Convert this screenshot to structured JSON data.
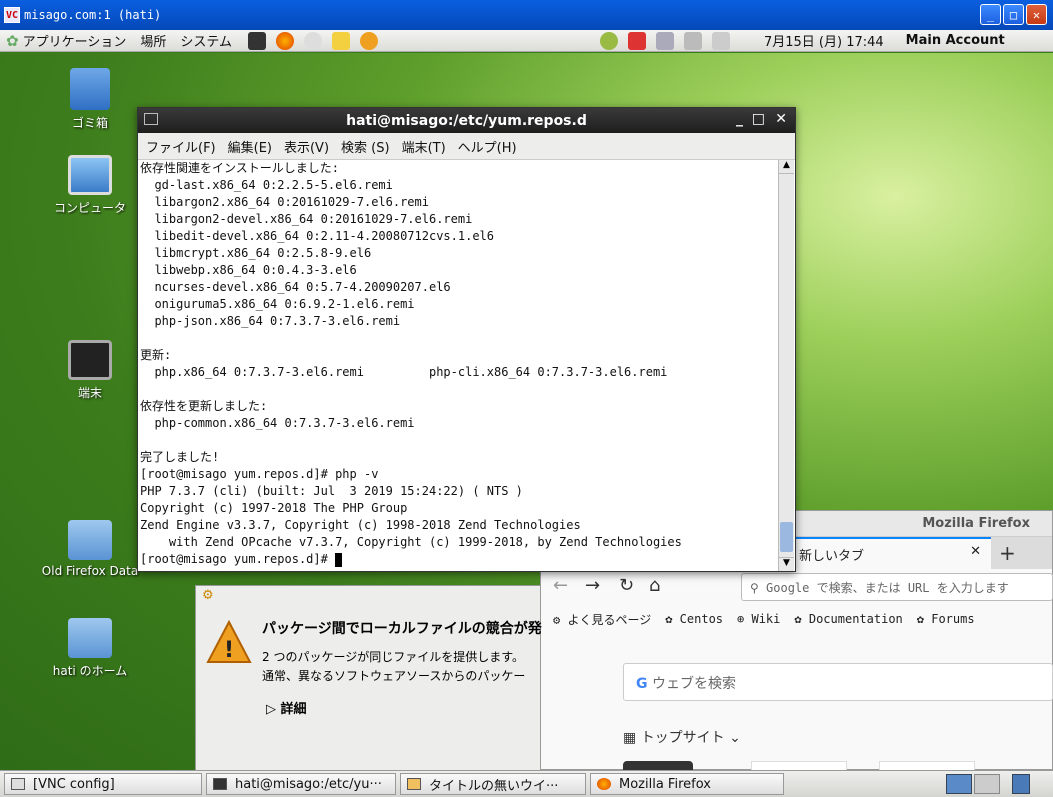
{
  "vnc": {
    "title": "misago.com:1 (hati)",
    "logo": "VC"
  },
  "panel": {
    "menus": [
      "アプリケーション",
      "場所",
      "システム"
    ],
    "clock": "7月15日 (月) 17:44",
    "account": "Main Account"
  },
  "desktop_icons": [
    "ゴミ箱",
    "コンピュータ",
    "端末",
    "Old Firefox Data",
    "hati のホーム"
  ],
  "terminal": {
    "title": "hati@misago:/etc/yum.repos.d",
    "menu": [
      "ファイル(F)",
      "編集(E)",
      "表示(V)",
      "検索 (S)",
      "端末(T)",
      "ヘルプ(H)"
    ],
    "lines": [
      "依存性関連をインストールしました:",
      "  gd-last.x86_64 0:2.2.5-5.el6.remi",
      "  libargon2.x86_64 0:20161029-7.el6.remi",
      "  libargon2-devel.x86_64 0:20161029-7.el6.remi",
      "  libedit-devel.x86_64 0:2.11-4.20080712cvs.1.el6",
      "  libmcrypt.x86_64 0:2.5.8-9.el6",
      "  libwebp.x86_64 0:0.4.3-3.el6",
      "  ncurses-devel.x86_64 0:5.7-4.20090207.el6",
      "  oniguruma5.x86_64 0:6.9.2-1.el6.remi",
      "  php-json.x86_64 0:7.3.7-3.el6.remi",
      "",
      "更新:",
      "  php.x86_64 0:7.3.7-3.el6.remi         php-cli.x86_64 0:7.3.7-3.el6.remi",
      "",
      "依存性を更新しました:",
      "  php-common.x86_64 0:7.3.7-3.el6.remi",
      "",
      "完了しました!",
      "[root@misago yum.repos.d]# php -v",
      "PHP 7.3.7 (cli) (built: Jul  3 2019 15:24:22) ( NTS )",
      "Copyright (c) 1997-2018 The PHP Group",
      "Zend Engine v3.3.7, Copyright (c) 1998-2018 Zend Technologies",
      "    with Zend OPcache v7.3.7, Copyright (c) 1999-2018, by Zend Technologies",
      "[root@misago yum.repos.d]# "
    ]
  },
  "dialog": {
    "heading": "パッケージ間でローカルファイルの競合が発",
    "text1": "2 つのパッケージが同じファイルを提供します。",
    "text2": "通常、異なるソフトウェアソースからのパッケー",
    "details": "詳細"
  },
  "firefox": {
    "title": "Mozilla Firefox",
    "tab": "新しいタブ",
    "urlbar_placeholder": "Google で検索、または URL を入力します",
    "bookmarks": [
      "よく見るページ",
      "Centos",
      "Wiki",
      "Documentation",
      "Forums"
    ],
    "search_placeholder": "ウェブを検索",
    "top_sites": "トップサイト"
  },
  "taskbar": {
    "items": [
      "[VNC config]",
      "hati@misago:/etc/yu···",
      "タイトルの無いウイ···",
      "Mozilla Firefox"
    ]
  }
}
